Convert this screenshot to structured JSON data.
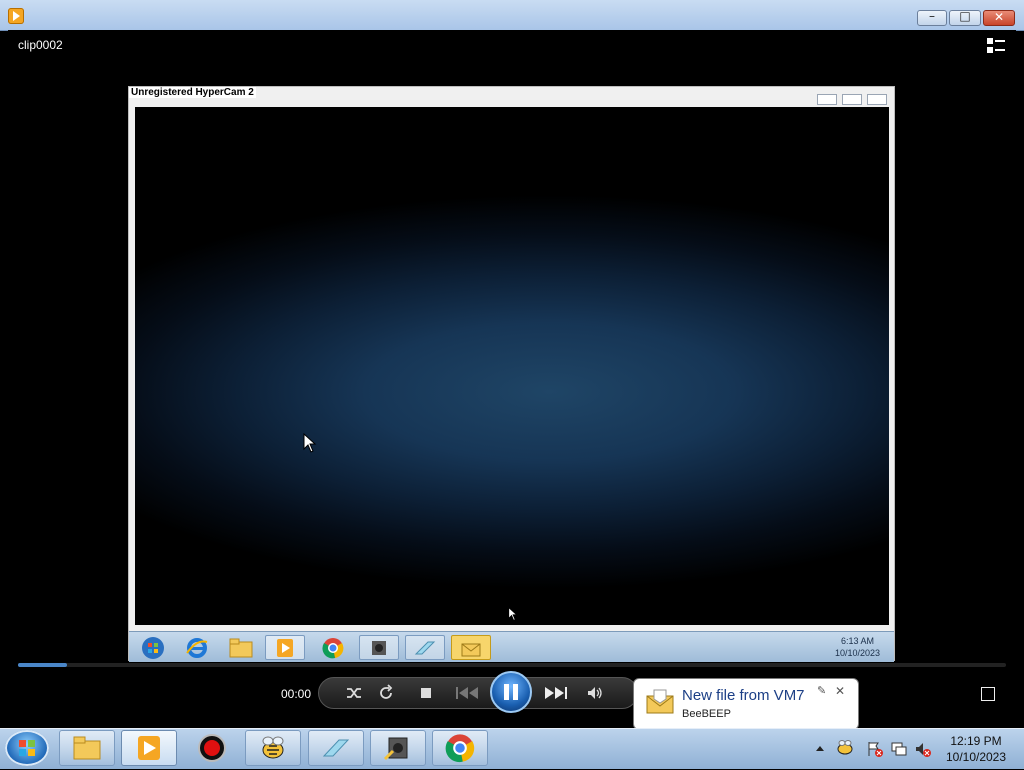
{
  "window": {
    "title": "",
    "clip_name": "clip0002",
    "buttons": {
      "minimize": "–",
      "maximize": "□",
      "close": "✕"
    }
  },
  "recording": {
    "caption": "Unregistered HyperCam 2",
    "taskbar_clock": {
      "time": "6:13 AM",
      "date": "10/10/2023"
    },
    "taskbar_icons": [
      "start-orb",
      "internet-explorer-icon",
      "folder-icon",
      "media-player-icon",
      "chrome-icon",
      "hypercam-icon",
      "notepad-icon",
      "beebeep-icon"
    ]
  },
  "player": {
    "time": "00:00",
    "progress_fraction": 0.05,
    "controls": [
      "shuffle-icon",
      "repeat-icon",
      "stop-icon",
      "previous-icon",
      "pause-icon",
      "next-icon",
      "volume-icon"
    ]
  },
  "notification": {
    "title": "New file from VM7",
    "app": "BeeBEEP",
    "close": "✕",
    "pin": "✎"
  },
  "taskbar": {
    "clock_time": "12:19 PM",
    "clock_date": "10/10/2023",
    "items": [
      "folder-icon",
      "media-player-icon",
      "record-icon",
      "beebeep-icon",
      "notepad-icon",
      "hypercam-icon",
      "chrome-icon"
    ]
  },
  "colors": {
    "accent": "#4a86c8",
    "taskbar": "#9fbcd8",
    "notification_title": "#1c3f86"
  }
}
